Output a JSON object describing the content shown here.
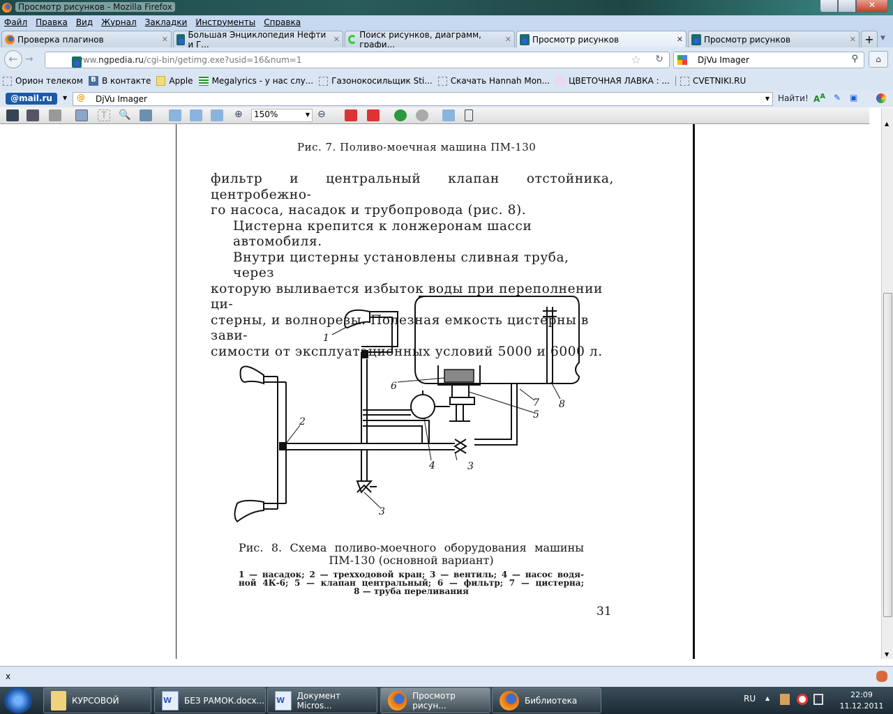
{
  "window": {
    "title": "Просмотр рисунков - Mozilla Firefox"
  },
  "menu": [
    "Файл",
    "Правка",
    "Вид",
    "Журнал",
    "Закладки",
    "Инструменты",
    "Справка"
  ],
  "tabs": [
    {
      "label": "Проверка плагинов",
      "active": false
    },
    {
      "label": "Большая Энциклопедия Нефти и Г...",
      "active": false
    },
    {
      "label": "Поиск рисунков, диаграмм, графи...",
      "active": false
    },
    {
      "label": "Просмотр рисунков",
      "active": true
    },
    {
      "label": "Просмотр рисунков",
      "active": false
    }
  ],
  "nav": {
    "url_domain": "www.ngpedia.ru",
    "url_host": "www.",
    "url_bold": "ngpedia.ru",
    "url_path": "/cgi-bin/getimg.exe?usid=16&num=1",
    "search_value": "DjVu Imager"
  },
  "bookmarks": [
    "Орион телеком",
    "В контакте",
    "Apple",
    "Megalyrics - у нас слу...",
    "Газонокосильщик Sti...",
    "Скачать Hannah Mon...",
    "ЦВЕТОЧНАЯ ЛАВКА : ...",
    "CVETNIKI.RU"
  ],
  "mailru": {
    "logo": "@mail.ru",
    "input_value": "DjVu Imager",
    "find_label": "Найти!"
  },
  "djvu": {
    "zoom": "150%"
  },
  "document": {
    "fig7_caption": "Рис. 7. Поливо-моечная машина ПМ-130",
    "paragraph_lines": [
      "фильтр и центральный клапан  отстойника, центробежно-",
      "го насоса, насадок и трубопровода (рис. 8).",
      "Цистерна крепится к лонжеронам шасси автомобиля.",
      "Внутри цистерны установлены сливная труба, через",
      "которую выливается избыток воды при переполнении ци-",
      "стерны, и волнорезы. Полезная емкость цистерны в зави-",
      "симости от эксплуатационных условий 5000 и 6000 л."
    ],
    "diagram_labels": [
      "1",
      "2",
      "3",
      "3",
      "4",
      "5",
      "6",
      "7",
      "8"
    ],
    "fig8_caption_1": "Рис. 8. Схема поливо-моечного оборудования машины",
    "fig8_caption_2": "ПМ-130 (основной вариант)",
    "legend_lines": [
      "1 — насадок; 2 — трехходовой кран; 3 — вентиль; 4 — насос водя-",
      "ной 4К-6; 5 — клапан центральный; 6 — фильтр; 7 — цистерна;",
      "8 — труба переливания"
    ],
    "page_number": "31"
  },
  "statusbar": {
    "close": "x"
  },
  "taskbar": {
    "items": [
      {
        "label": "КУРСОВОЙ",
        "icon": "folder-icon"
      },
      {
        "label": "БЕЗ РАМОК.docx...",
        "icon": "word-icon"
      },
      {
        "label": "Документ Micros...",
        "icon": "word-icon"
      },
      {
        "label": "Просмотр рисун...",
        "icon": "firefox-icon",
        "active": true
      },
      {
        "label": "Библиотека",
        "icon": "firefox-icon"
      }
    ],
    "lang": "RU",
    "time": "22:09",
    "date": "11.12.2011"
  }
}
